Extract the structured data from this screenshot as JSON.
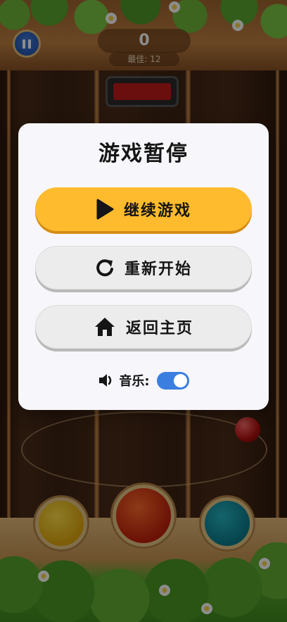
{
  "hud": {
    "score": "0",
    "best_label": "最佳: 12"
  },
  "pause_dialog": {
    "title": "游戏暂停",
    "resume_label": "继续游戏",
    "restart_label": "重新开始",
    "home_label": "返回主页",
    "music_label": "音乐:",
    "music_on": true
  },
  "icons": {
    "pause": "pause-icon",
    "resume": "play-icon",
    "restart": "refresh-icon",
    "home": "home-icon",
    "music": "speaker-icon"
  },
  "colors": {
    "primary_button": "#fdbb2d",
    "secondary_button": "#ececec",
    "toggle_on": "#3a7ee0",
    "dialog_bg": "#f7f6fa"
  }
}
